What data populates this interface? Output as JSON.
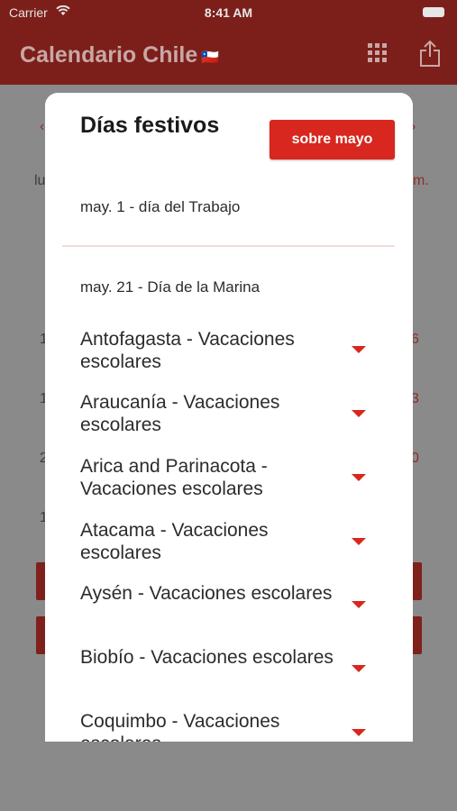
{
  "status_bar": {
    "carrier": "Carrier",
    "time": "8:41 AM"
  },
  "nav": {
    "title": "Calendario Chile",
    "flag": "🇨🇱",
    "grid_icon": "grid-icon",
    "share_icon": "share-icon"
  },
  "background": {
    "nav_left": "‹",
    "nav_right": "›",
    "weekday_left": "lu",
    "weekday_right": "m.",
    "row_left": [
      "1",
      "1",
      "2",
      "1"
    ],
    "row_right": [
      "6",
      "3",
      "0"
    ]
  },
  "modal": {
    "title": "Días festivos",
    "about_button": "sobre mayo",
    "holidays": [
      "may. 1 - día del Trabajo",
      "may. 21 - Día de la Marina"
    ],
    "regions": [
      "Antofagasta - Vacaciones escolares",
      "Araucanía - Vacaciones escolares",
      "Arica and Parinacota - Vacaciones escolares",
      "Atacama - Vacaciones escolares",
      "Aysén - Vacaciones escolares",
      "Biobío - Vacaciones escolares",
      "Coquimbo - Vacaciones escolares"
    ]
  },
  "colors": {
    "accent": "#d8271e",
    "nav_bg": "#7c1f1a",
    "overlay": "#8a8a8a"
  }
}
